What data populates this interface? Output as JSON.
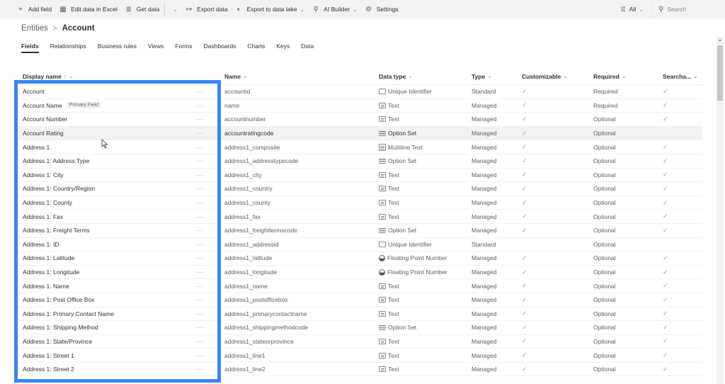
{
  "command_bar": {
    "add_field": "Add field",
    "edit_excel": "Edit data in Excel",
    "get_data": "Get data",
    "export_data": "Export data",
    "export_lake": "Export to data lake",
    "ai_builder": "AI Builder",
    "settings": "Settings",
    "filter_label": "All",
    "search_placeholder": "Search"
  },
  "icons": {
    "add": "+",
    "excel": "▦",
    "database": "≣",
    "chevron": "⌄",
    "export": "↦",
    "lake": "◐",
    "ai": "⚲",
    "gear": "⚙",
    "filter": "☰",
    "search": "⚲",
    "more": "···",
    "check": "✓",
    "sort_up": "↑"
  },
  "breadcrumb": {
    "parent": "Entities",
    "separator": ">",
    "current": "Account"
  },
  "tabs": [
    "Fields",
    "Relationships",
    "Business rules",
    "Views",
    "Forms",
    "Dashboards",
    "Charts",
    "Keys",
    "Data"
  ],
  "active_tab": "Fields",
  "columns": {
    "display_name": "Display name",
    "name": "Name",
    "data_type": "Data type",
    "type": "Type",
    "customizable": "Customizable",
    "required": "Required",
    "searchable": "Searcha..."
  },
  "primary_badge": "Primary Field",
  "rows": [
    {
      "display": "Account",
      "name": "accountid",
      "dtype": "Unique Identifier",
      "dicon": "box",
      "type": "Standard",
      "cust": true,
      "req": "Required",
      "search": true,
      "badge": false
    },
    {
      "display": "Account Name",
      "name": "name",
      "dtype": "Text",
      "dicon": "text",
      "type": "Managed",
      "cust": true,
      "req": "Required",
      "search": true,
      "badge": true
    },
    {
      "display": "Account Number",
      "name": "accountnumber",
      "dtype": "Text",
      "dicon": "text",
      "type": "Managed",
      "cust": true,
      "req": "Optional",
      "search": true,
      "badge": false
    },
    {
      "display": "Account Rating",
      "name": "accountratingcode",
      "dtype": "Option Set",
      "dicon": "opt",
      "type": "Managed",
      "cust": true,
      "req": "Optional",
      "search": false,
      "badge": false,
      "hover": true
    },
    {
      "display": "Address 1",
      "name": "address1_composite",
      "dtype": "Multiline Text",
      "dicon": "multi",
      "type": "Managed",
      "cust": true,
      "req": "Optional",
      "search": true,
      "badge": false
    },
    {
      "display": "Address 1: Address Type",
      "name": "address1_addresstypecode",
      "dtype": "Option Set",
      "dicon": "opt",
      "type": "Managed",
      "cust": true,
      "req": "Optional",
      "search": true,
      "badge": false
    },
    {
      "display": "Address 1: City",
      "name": "address1_city",
      "dtype": "Text",
      "dicon": "text",
      "type": "Managed",
      "cust": true,
      "req": "Optional",
      "search": true,
      "badge": false
    },
    {
      "display": "Address 1: Country/Region",
      "name": "address1_country",
      "dtype": "Text",
      "dicon": "text",
      "type": "Managed",
      "cust": true,
      "req": "Optional",
      "search": true,
      "badge": false
    },
    {
      "display": "Address 1: County",
      "name": "address1_county",
      "dtype": "Text",
      "dicon": "text",
      "type": "Managed",
      "cust": true,
      "req": "Optional",
      "search": true,
      "badge": false
    },
    {
      "display": "Address 1: Fax",
      "name": "address1_fax",
      "dtype": "Text",
      "dicon": "text",
      "type": "Managed",
      "cust": true,
      "req": "Optional",
      "search": true,
      "badge": false
    },
    {
      "display": "Address 1: Freight Terms",
      "name": "address1_freighttermscode",
      "dtype": "Option Set",
      "dicon": "opt",
      "type": "Managed",
      "cust": true,
      "req": "Optional",
      "search": true,
      "badge": false
    },
    {
      "display": "Address 1: ID",
      "name": "address1_addressid",
      "dtype": "Unique Identifier",
      "dicon": "box",
      "type": "Standard",
      "cust": false,
      "req": "Optional",
      "search": false,
      "badge": false
    },
    {
      "display": "Address 1: Latitude",
      "name": "address1_latitude",
      "dtype": "Floating Point Number",
      "dicon": "float",
      "type": "Managed",
      "cust": true,
      "req": "Optional",
      "search": true,
      "badge": false
    },
    {
      "display": "Address 1: Longitude",
      "name": "address1_longitude",
      "dtype": "Floating Point Number",
      "dicon": "float",
      "type": "Managed",
      "cust": true,
      "req": "Optional",
      "search": true,
      "badge": false
    },
    {
      "display": "Address 1: Name",
      "name": "address1_name",
      "dtype": "Text",
      "dicon": "text",
      "type": "Managed",
      "cust": true,
      "req": "Optional",
      "search": true,
      "badge": false
    },
    {
      "display": "Address 1: Post Office Box",
      "name": "address1_postofficebox",
      "dtype": "Text",
      "dicon": "text",
      "type": "Managed",
      "cust": true,
      "req": "Optional",
      "search": true,
      "badge": false
    },
    {
      "display": "Address 1: Primary Contact Name",
      "name": "address1_primarycontactname",
      "dtype": "Text",
      "dicon": "text",
      "type": "Managed",
      "cust": true,
      "req": "Optional",
      "search": true,
      "badge": false
    },
    {
      "display": "Address 1: Shipping Method",
      "name": "address1_shippingmethodcode",
      "dtype": "Option Set",
      "dicon": "opt",
      "type": "Managed",
      "cust": true,
      "req": "Optional",
      "search": true,
      "badge": false
    },
    {
      "display": "Address 1: State/Province",
      "name": "address1_stateorprovince",
      "dtype": "Text",
      "dicon": "text",
      "type": "Managed",
      "cust": true,
      "req": "Optional",
      "search": true,
      "badge": false
    },
    {
      "display": "Address 1: Street 1",
      "name": "address1_line1",
      "dtype": "Text",
      "dicon": "text",
      "type": "Managed",
      "cust": true,
      "req": "Optional",
      "search": true,
      "badge": false
    },
    {
      "display": "Address 1: Street 2",
      "name": "address1_line2",
      "dtype": "Text",
      "dicon": "text",
      "type": "Managed",
      "cust": true,
      "req": "Optional",
      "search": true,
      "badge": false
    }
  ],
  "colors": {
    "highlight_box": "#3a86f0",
    "command_bar_bg": "#f3f2f1",
    "hover_row_bg": "#f3f2f1"
  }
}
